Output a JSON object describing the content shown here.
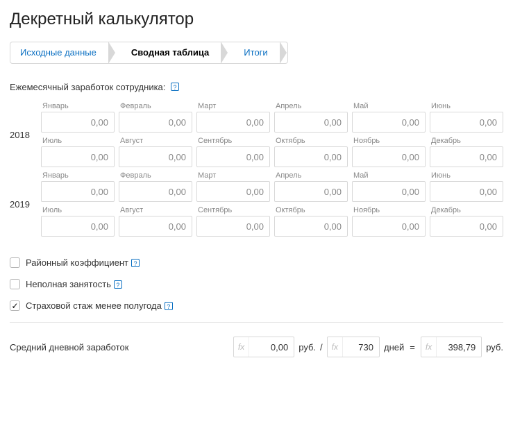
{
  "title": "Декретный калькулятор",
  "steps": {
    "source": "Исходные данные",
    "table": "Сводная таблица",
    "totals": "Итоги"
  },
  "section_label": "Ежемесячный заработок сотрудника:",
  "help_glyph": "?",
  "months": [
    "Январь",
    "Февраль",
    "Март",
    "Апрель",
    "Май",
    "Июнь",
    "Июль",
    "Август",
    "Сентябрь",
    "Октябрь",
    "Ноябрь",
    "Декабрь"
  ],
  "years": [
    {
      "year": "2018",
      "values": [
        "0,00",
        "0,00",
        "0,00",
        "0,00",
        "0,00",
        "0,00",
        "0,00",
        "0,00",
        "0,00",
        "0,00",
        "0,00",
        "0,00"
      ]
    },
    {
      "year": "2019",
      "values": [
        "0,00",
        "0,00",
        "0,00",
        "0,00",
        "0,00",
        "0,00",
        "0,00",
        "0,00",
        "0,00",
        "0,00",
        "0,00",
        "0,00"
      ]
    }
  ],
  "checks": {
    "regional": {
      "label": "Районный коэффициент",
      "checked": false
    },
    "parttime": {
      "label": "Неполная занятость",
      "checked": false
    },
    "under6m": {
      "label": "Страховой стаж менее полугода",
      "checked": true
    }
  },
  "result": {
    "label": "Средний дневной заработок",
    "earnings": "0,00",
    "unit_rub": "руб.",
    "slash": "/",
    "days": "730",
    "unit_days": "дней",
    "eq": "=",
    "avg": "398,79"
  }
}
